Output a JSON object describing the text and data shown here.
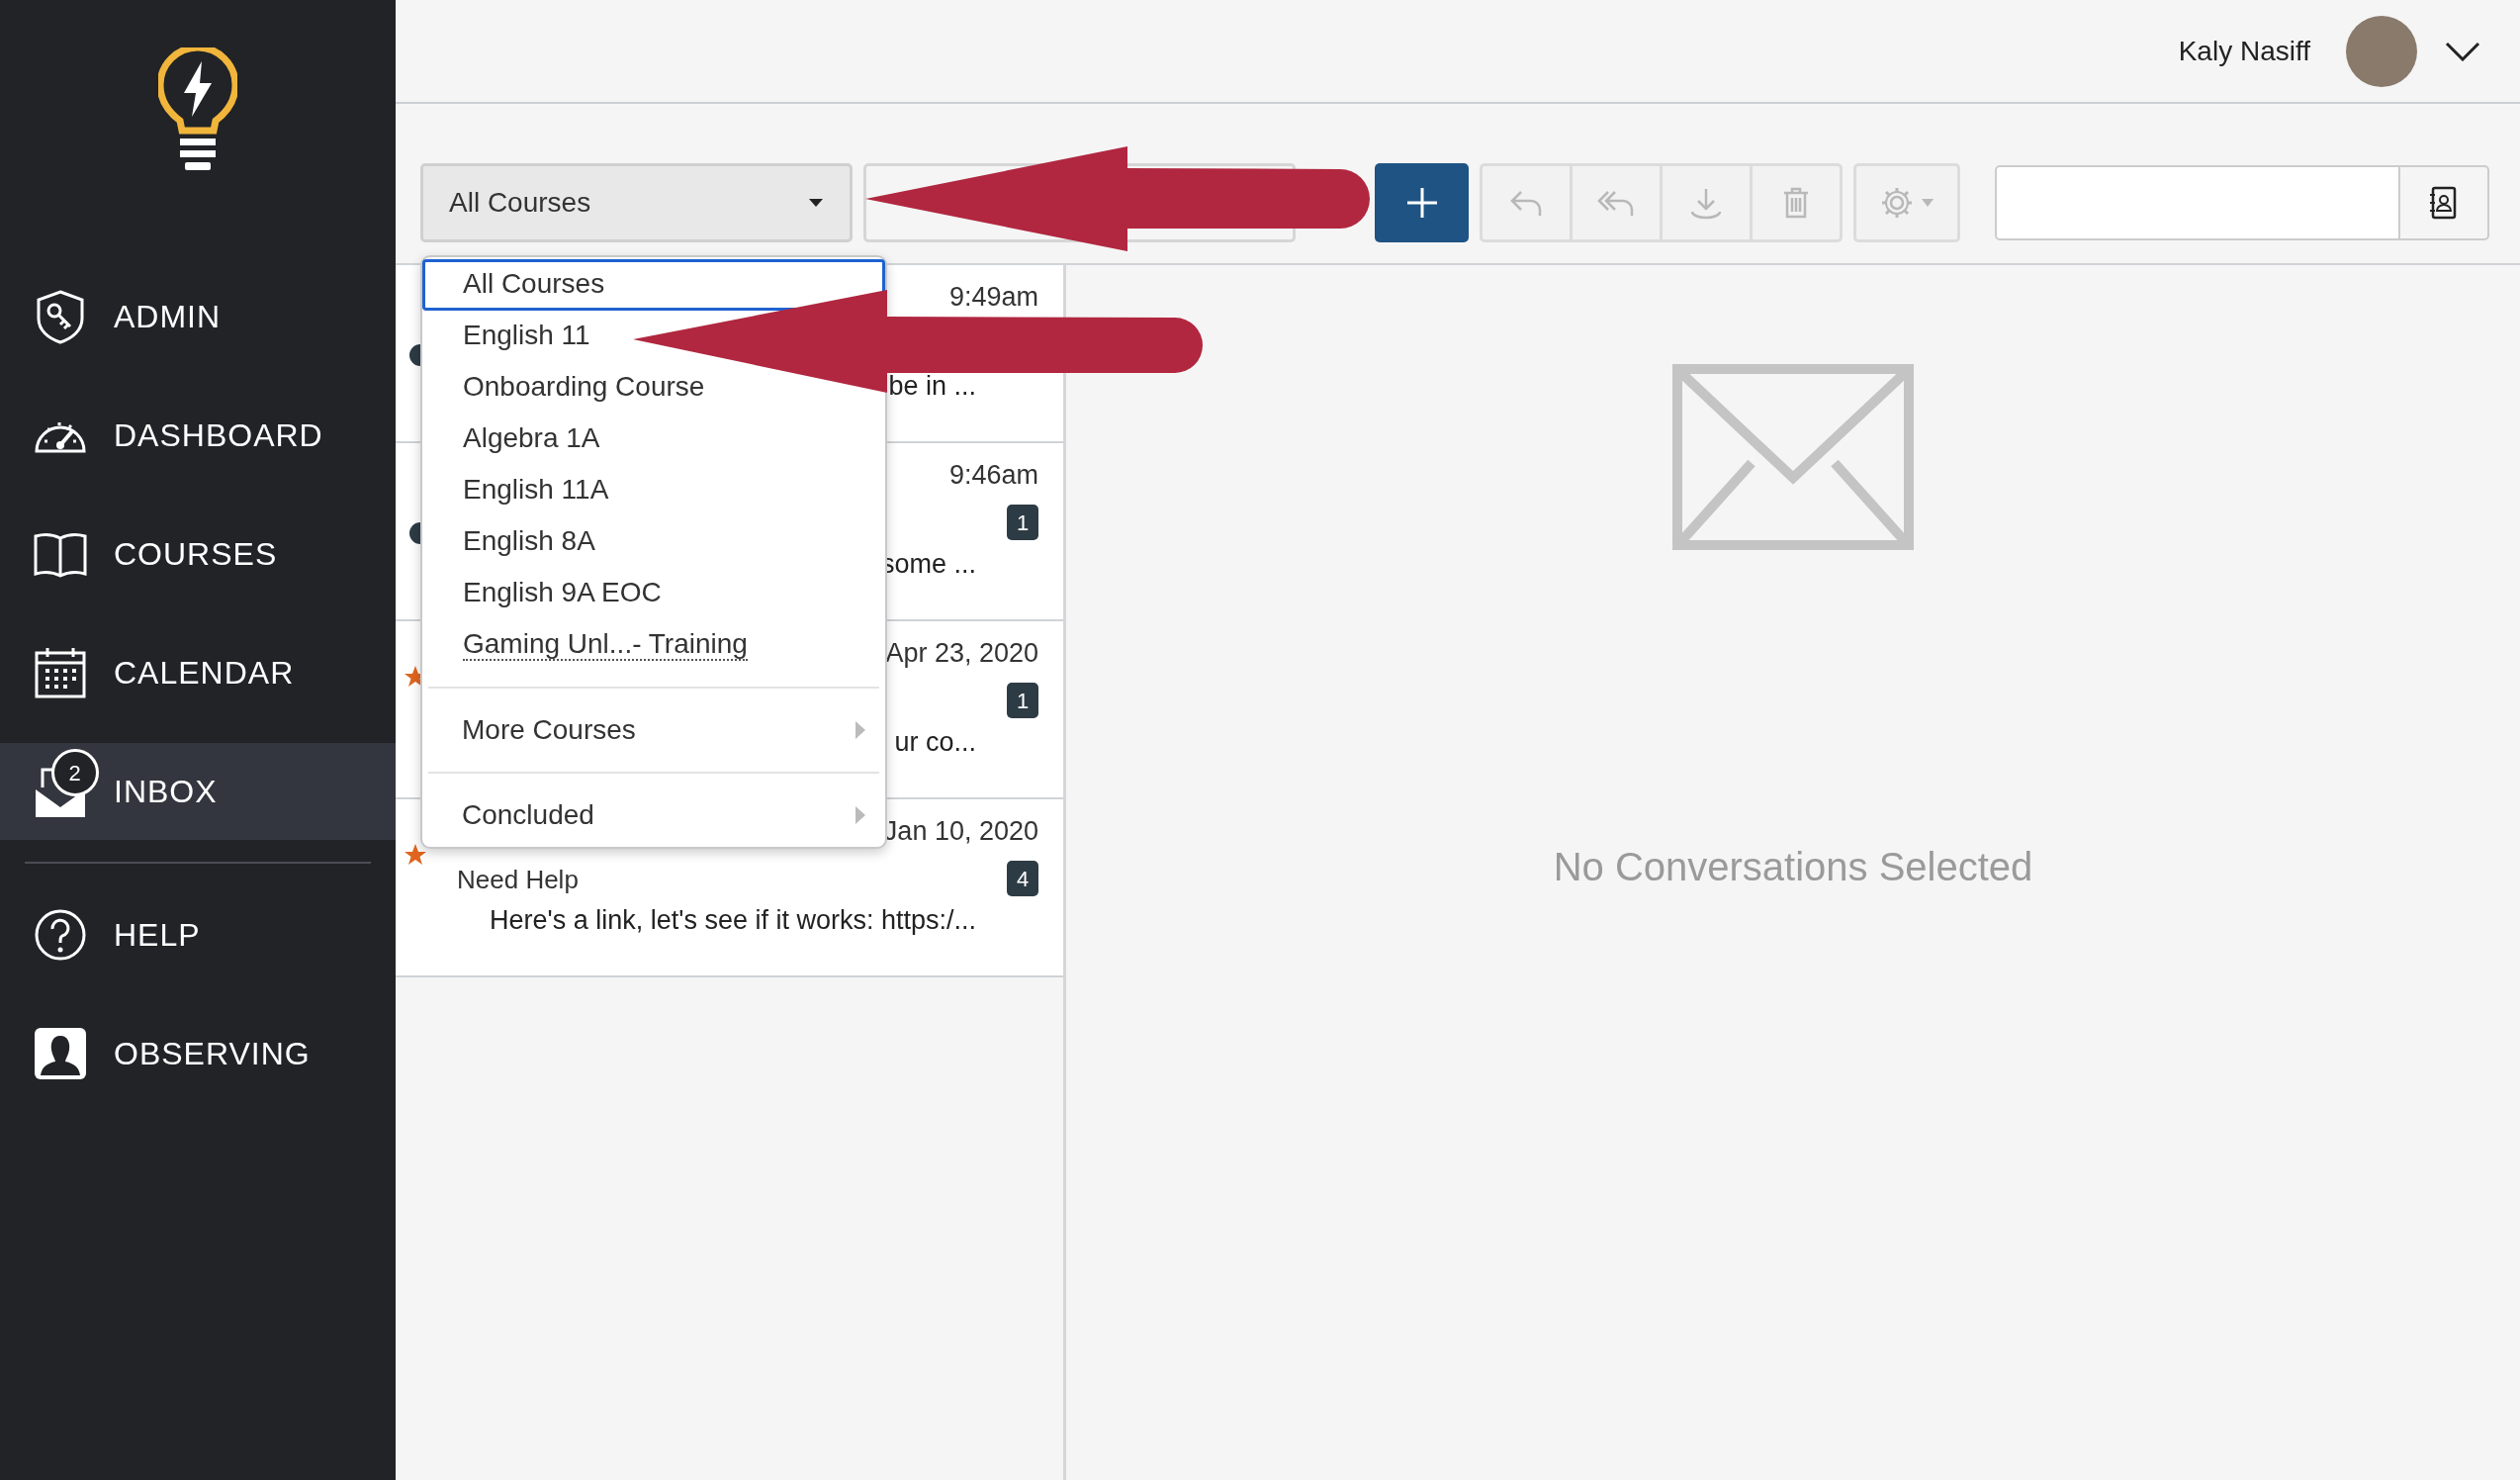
{
  "sidebar": {
    "items": [
      {
        "label": "ADMIN",
        "selected": false
      },
      {
        "label": "DASHBOARD",
        "selected": false
      },
      {
        "label": "COURSES",
        "selected": false
      },
      {
        "label": "CALENDAR",
        "selected": false
      },
      {
        "label": "INBOX",
        "badge": "2",
        "selected": true
      }
    ],
    "secondary_items": [
      {
        "label": "HELP",
        "selected": false
      },
      {
        "label": "OBSERVING",
        "selected": false
      }
    ]
  },
  "user": {
    "name": "Kaly Nasiff"
  },
  "toolbar": {
    "course_filter": {
      "value": "All Courses"
    }
  },
  "course_menu": {
    "items": [
      {
        "label": "All Courses",
        "selected": true,
        "abbreviated": false
      },
      {
        "label": "English 11",
        "selected": false,
        "abbreviated": false
      },
      {
        "label": "Onboarding Course",
        "selected": false,
        "abbreviated": false
      },
      {
        "label": "Algebra 1A",
        "selected": false,
        "abbreviated": false
      },
      {
        "label": "English 11A",
        "selected": false,
        "abbreviated": false
      },
      {
        "label": "English 8A",
        "selected": false,
        "abbreviated": false
      },
      {
        "label": "English 9A EOC",
        "selected": false,
        "abbreviated": false
      },
      {
        "label": "Gaming Unl...- Training",
        "selected": false,
        "abbreviated": true
      }
    ],
    "submenus": [
      {
        "label": "More Courses"
      },
      {
        "label": "Concluded"
      }
    ]
  },
  "conversations": [
    {
      "date": "9:49am",
      "preview": "be in ...",
      "unread": true,
      "starred": false
    },
    {
      "date": "9:46am",
      "preview": "some ...",
      "count": "1",
      "unread": true,
      "starred": false
    },
    {
      "date": "Apr 23, 2020",
      "preview": "ur co...",
      "count": "1",
      "unread": false,
      "starred": true
    },
    {
      "date": "Jan 10, 2020",
      "subject": "Need Help",
      "preview": "Here's a link, let's see if it works: https:/...",
      "count": "4",
      "unread": false,
      "starred": true
    }
  ],
  "empty_state": {
    "message": "No Conversations Selected"
  }
}
